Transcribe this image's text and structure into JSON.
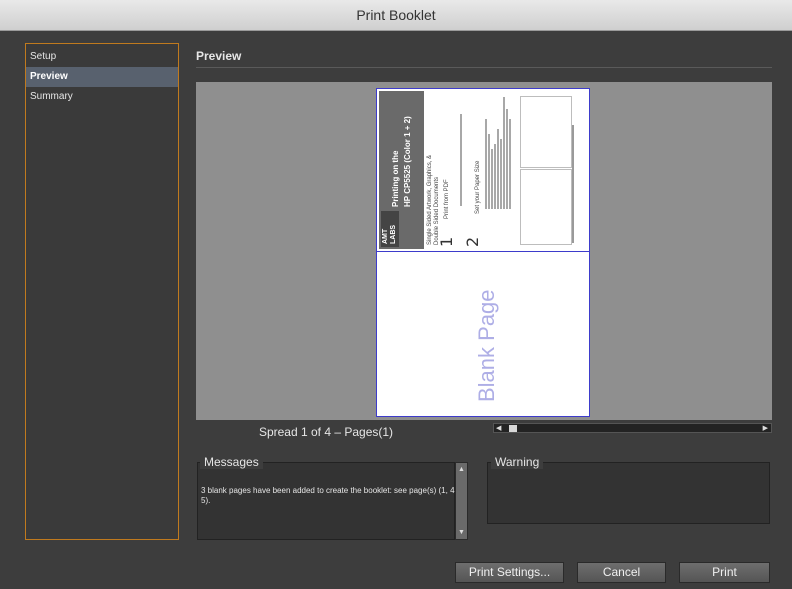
{
  "window": {
    "title": "Print Booklet"
  },
  "sidebar": {
    "items": [
      {
        "label": "Setup"
      },
      {
        "label": "Preview"
      },
      {
        "label": "Summary"
      }
    ]
  },
  "preview": {
    "section_title": "Preview",
    "spread_label": "Spread 1 of 4 – Pages(1)",
    "page": {
      "heading_line1": "Printing on the",
      "heading_line2": "HP CP5525 (Color 1 + 2)",
      "logo_line1": "AMT",
      "logo_line2": "LABS",
      "subtitle_line1": "Single Sided Artwork, Graphics, &",
      "subtitle_line2": "Double Sided Documents",
      "step1_label": "Print from PDF",
      "step1_number": "1",
      "step2_label": "Set your Paper Size",
      "step2_number": "2",
      "blank_text": "Blank Page"
    }
  },
  "messages": {
    "label": "Messages",
    "text": "3 blank pages have been added to create the booklet: see page(s) (1, 4, 5)."
  },
  "warning": {
    "label": "Warning",
    "text": ""
  },
  "buttons": {
    "print_settings": "Print Settings...",
    "cancel": "Cancel",
    "print": "Print"
  },
  "icons": {
    "scroll_left": "scroll-left-arrow-icon",
    "scroll_right": "scroll-right-arrow-icon",
    "scroll_up": "scroll-up-arrow-icon",
    "scroll_down": "scroll-down-arrow-icon"
  },
  "colors": {
    "accent_border": "#c07a1e",
    "selected_item": "#58616e",
    "page_border": "#3d3bcb",
    "blank_text": "#aeaee6"
  }
}
